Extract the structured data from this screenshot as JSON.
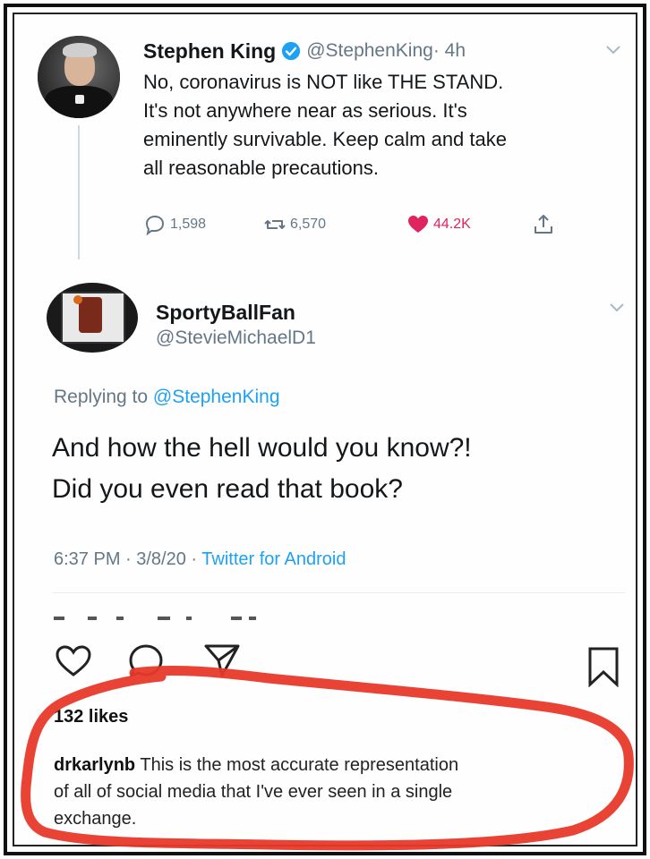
{
  "original_tweet": {
    "display_name": "Stephen King",
    "handle": "@StephenKing",
    "age": "· 4h",
    "text_lines": [
      "No, coronavirus is NOT like THE STAND.",
      "It's not anywhere near as serious. It's",
      "eminently survivable. Keep calm and take",
      "all reasonable precautions."
    ],
    "reply_count": "1,598",
    "retweet_count": "6,570",
    "like_count": "44.2K",
    "liked": true
  },
  "reply_tweet": {
    "display_name": "SportyBallFan",
    "handle": "@StevieMichaelD1",
    "replying_prefix": "Replying to",
    "replying_to": "@StephenKing",
    "text_lines": [
      "And how the hell would you know?!",
      "Did you even read that book?"
    ],
    "time_date": "6:37 PM · 3/8/20 ·",
    "source": "Twitter for Android"
  },
  "instagram_post": {
    "likes": "132 likes",
    "comment_user": "drkarlynb",
    "caption_lines": [
      " This is the most accurate representation",
      "of all of social media that I've ever seen in a single",
      "exchange."
    ]
  },
  "colors": {
    "twitter_blue": "#1da1f2",
    "muted_gray": "#657786",
    "like_red": "#e0245e",
    "annotation_red": "#e8392a"
  },
  "icons": [
    "verified-badge-icon",
    "chevron-down-icon",
    "reply-icon",
    "retweet-icon",
    "heart-filled-icon",
    "share-icon",
    "heart-outline-icon",
    "comment-icon",
    "send-icon",
    "bookmark-icon"
  ]
}
